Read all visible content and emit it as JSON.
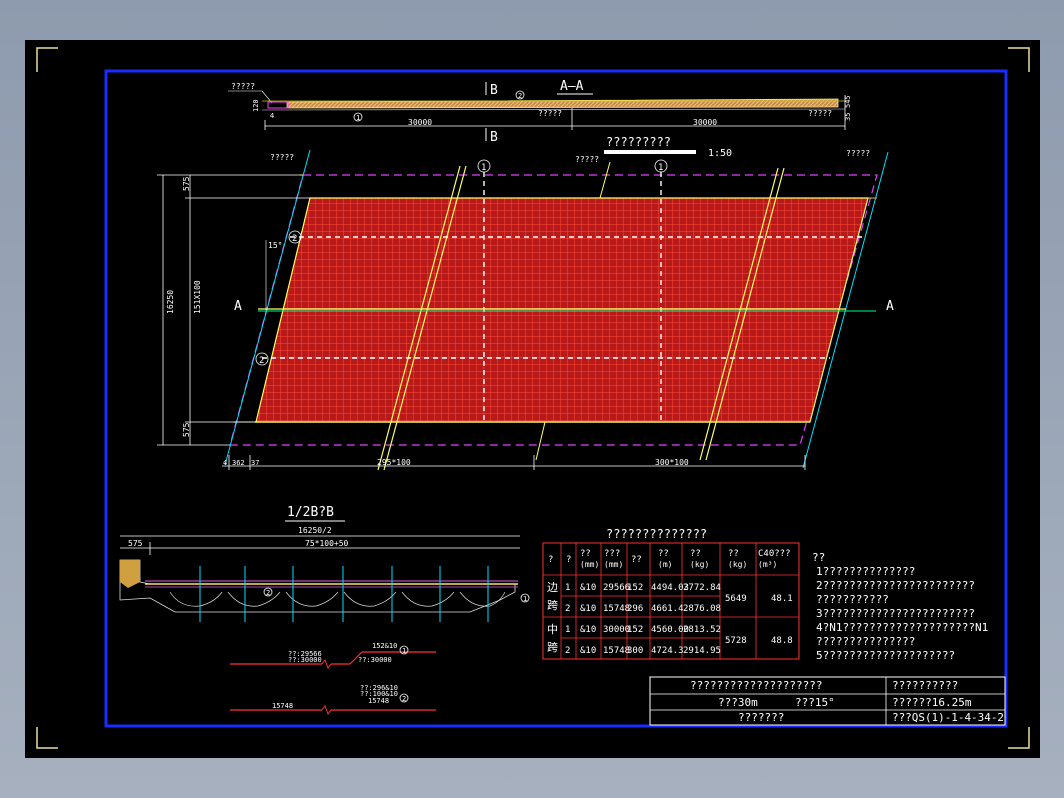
{
  "section_title": "A—A",
  "section_marks": {
    "b_top": "B",
    "b_bottom": "B",
    "a_left": "A",
    "a_right": "A"
  },
  "top_section": {
    "label_left": "?????",
    "mark_1": "1",
    "mark_2": "2",
    "dim_120": "120",
    "dim_4": "4",
    "dim_left": "30000",
    "dim_right": "30000",
    "label_mid": "?????",
    "label_right": "?????",
    "dim_side_top": "545",
    "dim_side_bottom": "35"
  },
  "plan": {
    "title": "?????????",
    "scale": "1:50",
    "label_top_left": "?????",
    "label_top_mid": "?????",
    "label_top_right": "?????",
    "markers": [
      "1",
      "1",
      "2",
      "2"
    ],
    "angle": "15°",
    "dim_total_height": "16250",
    "dim_575_top": "575",
    "dim_575_bottom": "575",
    "dim_mid": "151X100",
    "dim_bottom": [
      "4",
      "362",
      "37",
      "295*100",
      "300*100"
    ]
  },
  "cross_section": {
    "title": "1/2B?B",
    "dim_half": "16250/2",
    "dim_575": "575",
    "dim_spacing": "75*100+50",
    "marks": [
      "2",
      "1"
    ]
  },
  "bar_details": [
    {
      "line1": "??:29566",
      "line2": "??:30000",
      "right1": "152&10",
      "right2": "??:30000",
      "mark": "1",
      "len": ""
    },
    {
      "line1": "??:296&10",
      "line2": "??:100&10",
      "right1": "15748",
      "right2": "",
      "mark": "2",
      "len": "15748"
    }
  ],
  "table": {
    "title": "??????????????",
    "headers": [
      "?",
      "?",
      "??\n(mm)",
      "???\n(mm)",
      "??",
      "??\n(m)",
      "??\n(kg)",
      "??\n(kg)",
      "C40???\n(m³)"
    ],
    "groups": [
      {
        "name": "边跨",
        "rows": [
          [
            "1",
            "&10",
            "29566",
            "152",
            "4494.03",
            "2772.84"
          ],
          [
            "2",
            "&10",
            "15748",
            "296",
            "4661.4",
            "2876.08"
          ]
        ],
        "total": "5649",
        "volume": "48.1"
      },
      {
        "name": "中跨",
        "rows": [
          [
            "1",
            "&10",
            "30000",
            "152",
            "4560.00",
            "2813.52"
          ],
          [
            "2",
            "&10",
            "15748",
            "300",
            "4724.3",
            "2914.95"
          ]
        ],
        "total": "5728",
        "volume": "48.8"
      }
    ]
  },
  "notes": {
    "heading": "??",
    "items": [
      "1??????????????",
      "2???????????????????????",
      "    ???????????",
      "3???????????????????????",
      "4?N1????????????????????N1",
      "    ???????????????",
      "5????????????????????"
    ]
  },
  "title_block": {
    "main_title": "????????????????????",
    "span": "???30m",
    "skew": "???15°",
    "sub_title": "???????",
    "r1": "??????????",
    "r2": "??????16.25m",
    "r3": "???QS(1)-1-4-34-2"
  }
}
